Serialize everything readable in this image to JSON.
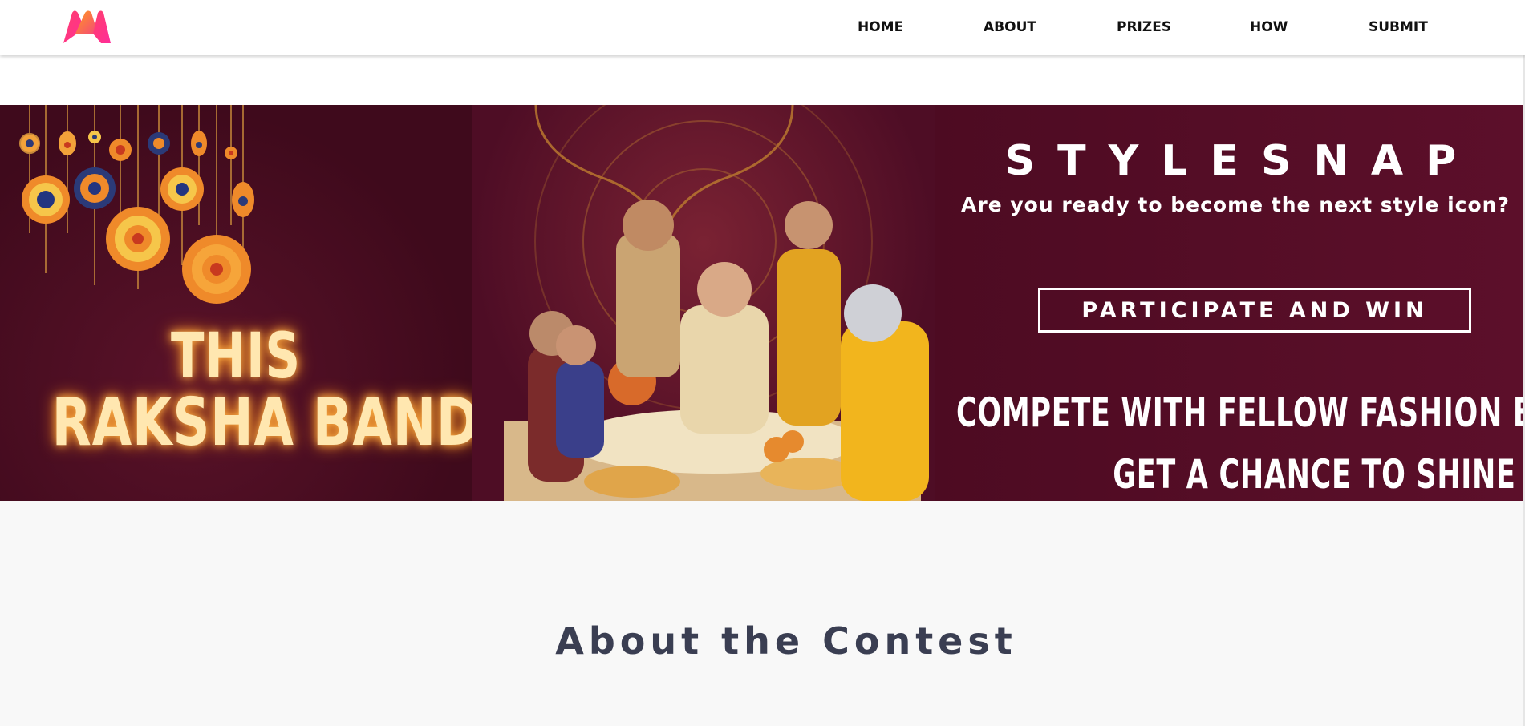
{
  "navbar": {
    "logo_icon": "myntra-m-logo",
    "links": [
      "HOME",
      "ABOUT",
      "PRIZES",
      "HOW",
      "SUBMIT"
    ]
  },
  "banner": {
    "left_line1": "THIS",
    "left_line2": "RAKSHA BANDHAN",
    "title": "STYLESNAP",
    "tagline": "Are you ready to become the next style icon?",
    "cta": "PARTICIPATE AND WIN",
    "compete": "COMPETE WITH FELLOW FASHION ENTHUSIASTS",
    "shine": "GET A CHANCE TO SHINE",
    "colors": {
      "maroon": "#4e0d25",
      "gold": "#c8893a",
      "glow": "#ffe7b0"
    }
  },
  "about": {
    "title": "About the Contest"
  }
}
